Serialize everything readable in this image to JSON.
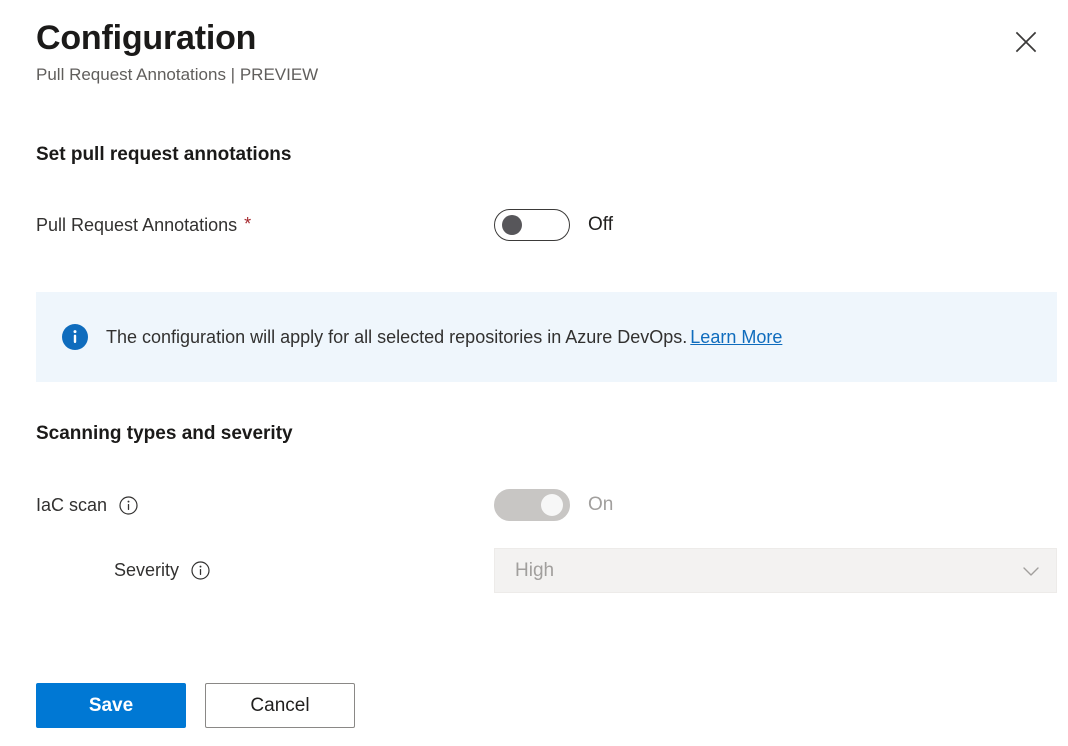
{
  "header": {
    "title": "Configuration",
    "subtitle": "Pull Request Annotations | PREVIEW",
    "close_label": "Close"
  },
  "sections": {
    "set_annotations": {
      "heading": "Set pull request annotations",
      "field": {
        "label": "Pull Request Annotations",
        "required_marker": "*",
        "toggle_state_text": "Off"
      }
    },
    "scanning": {
      "heading": "Scanning types and severity",
      "iac": {
        "label": "IaC scan",
        "toggle_state_text": "On"
      },
      "severity": {
        "label": "Severity",
        "selected_value": "High",
        "options": [
          "High"
        ]
      }
    }
  },
  "banner": {
    "text": "The configuration will apply for all selected repositories in Azure DevOps.",
    "link_text": "Learn More"
  },
  "footer": {
    "save_label": "Save",
    "cancel_label": "Cancel"
  },
  "colors": {
    "primary": "#0078d4",
    "banner_bg": "#eff6fc",
    "banner_icon": "#0f6cbd",
    "link": "#0f6cbd",
    "required": "#a4262c",
    "disabled_text": "#a19f9d"
  }
}
